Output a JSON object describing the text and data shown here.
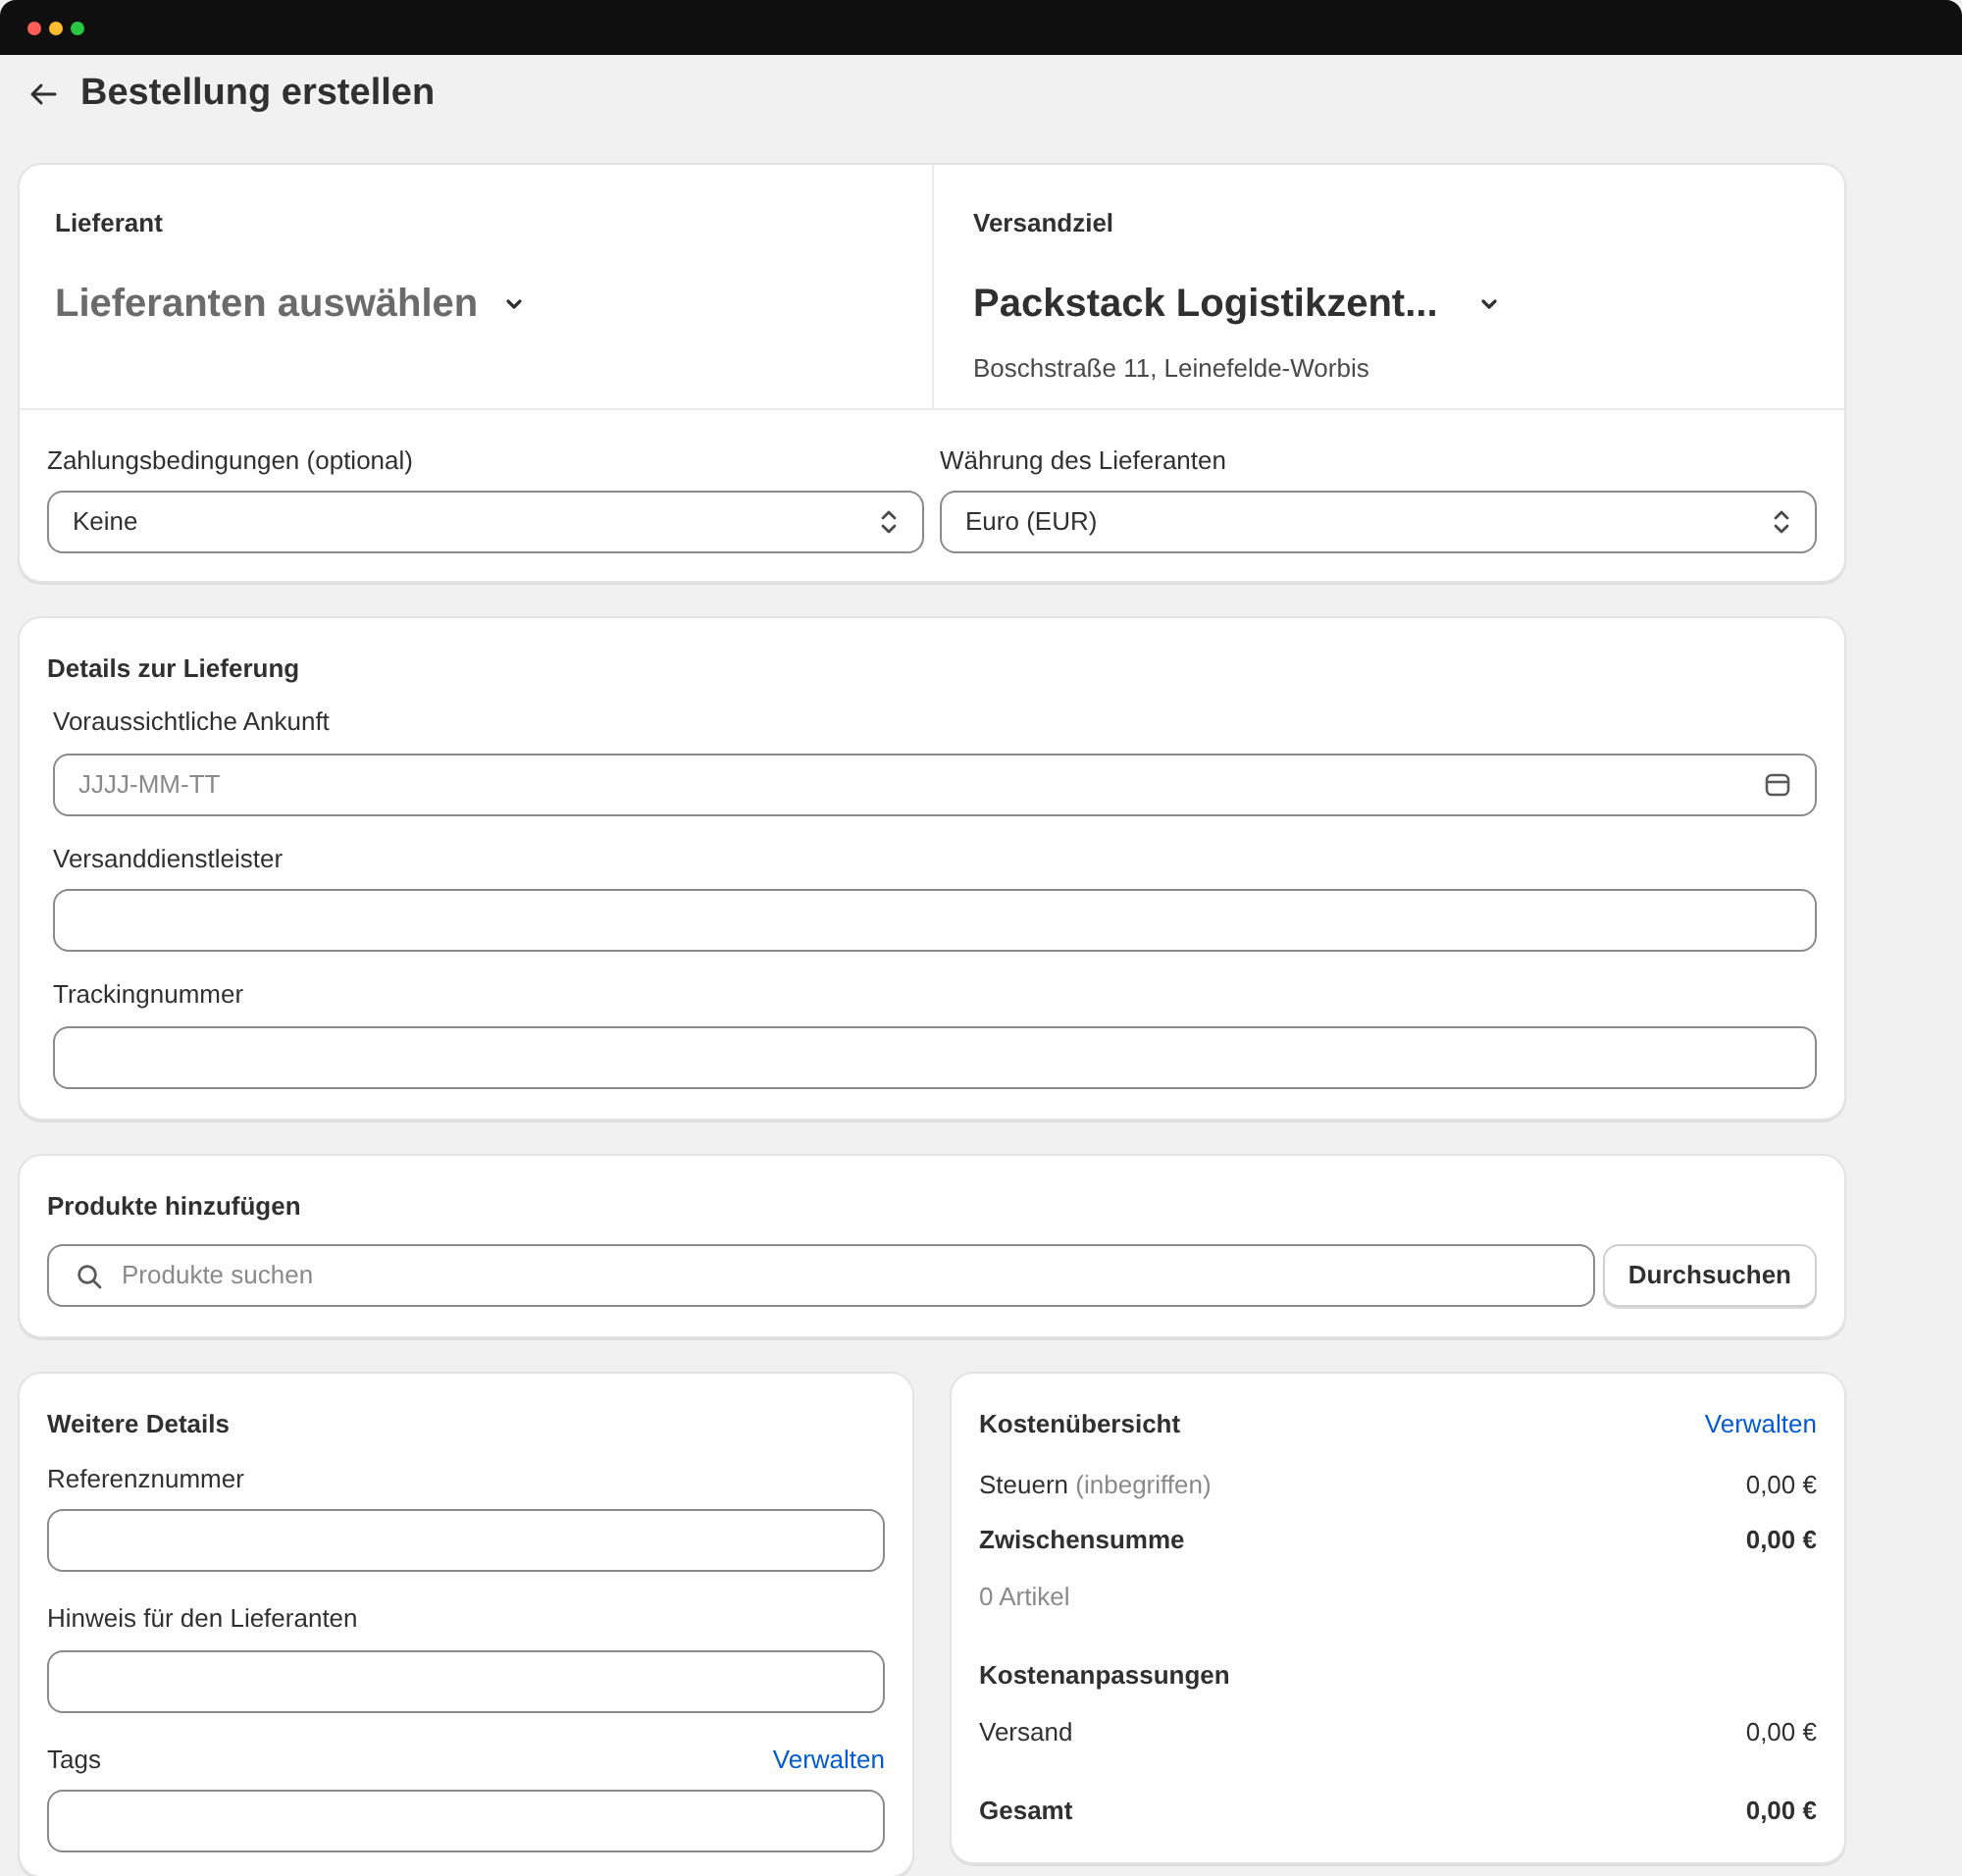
{
  "page": {
    "title": "Bestellung erstellen"
  },
  "supplier": {
    "label": "Lieferant",
    "placeholder": "Lieferanten auswählen"
  },
  "destination": {
    "label": "Versandziel",
    "name": "Packstack Logistikzent...",
    "address": "Boschstraße 11, Leinefelde-Worbis"
  },
  "selects": [
    {
      "label": "Zahlungsbedingungen (optional)",
      "value": "Keine"
    },
    {
      "label": "Währung des Lieferanten",
      "value": "Euro (EUR)"
    }
  ],
  "delivery": {
    "title": "Details zur Lieferung",
    "fields": [
      {
        "label": "Voraussichtliche Ankunft",
        "placeholder": "JJJJ-MM-TT",
        "kind": "date"
      },
      {
        "label": "Versanddienstleister",
        "kind": "text"
      },
      {
        "label": "Trackingnummer",
        "kind": "text"
      }
    ]
  },
  "products": {
    "title": "Produkte hinzufügen",
    "placeholder": "Produkte suchen",
    "button": "Durchsuchen"
  },
  "more_details": {
    "title": "Weitere Details",
    "fields": [
      {
        "label": "Referenznummer"
      },
      {
        "label": "Hinweis für den Lieferanten"
      },
      {
        "label": "Tags",
        "link": "Verwalten"
      }
    ]
  },
  "cost_summary": {
    "title": "Kostenübersicht",
    "link": "Verwalten",
    "rows": [
      {
        "kind": "line",
        "label": "Steuern",
        "note": "(inbegriffen)",
        "value": "0,00 €"
      },
      {
        "kind": "strong",
        "label": "Zwischensumme",
        "value": "0,00 €"
      },
      {
        "kind": "muted",
        "label": "0 Artikel"
      },
      {
        "kind": "heading",
        "label": "Kostenanpassungen"
      },
      {
        "kind": "line",
        "label": "Versand",
        "value": "0,00 €"
      },
      {
        "kind": "total",
        "label": "Gesamt",
        "value": "0,00 €"
      }
    ]
  }
}
